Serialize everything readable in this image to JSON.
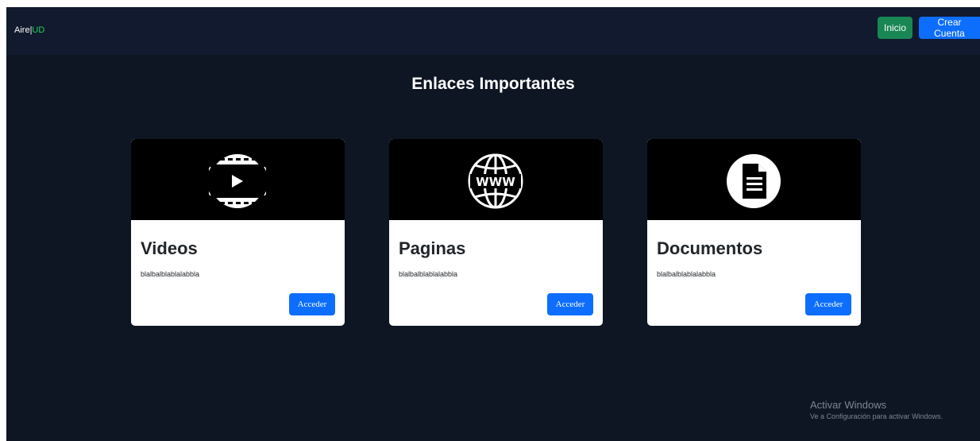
{
  "navbar": {
    "brand_main": "Aire",
    "brand_sep": "|",
    "brand_accent": "UD",
    "inicio_label": "Inicio",
    "crear_label": "Crear Cuenta"
  },
  "main": {
    "title": "Enlaces Importantes",
    "cards": [
      {
        "icon": "video-play-icon",
        "title": "Videos",
        "text": "blalbalblablalabbla",
        "button": "Acceder"
      },
      {
        "icon": "www-globe-icon",
        "title": "Paginas",
        "text": "blalbalblablalabbla",
        "button": "Acceder"
      },
      {
        "icon": "document-icon",
        "title": "Documentos",
        "text": "blalbalblablalabbla",
        "button": "Acceder"
      }
    ]
  },
  "watermark": {
    "title": "Activar Windows",
    "subtitle": "Ve a Configuración para activar Windows."
  },
  "colors": {
    "background": "#0e1523",
    "navbar": "#111a2e",
    "brand_accent": "#1fd655",
    "primary_button": "#0d6efd",
    "success_button": "#198754"
  }
}
